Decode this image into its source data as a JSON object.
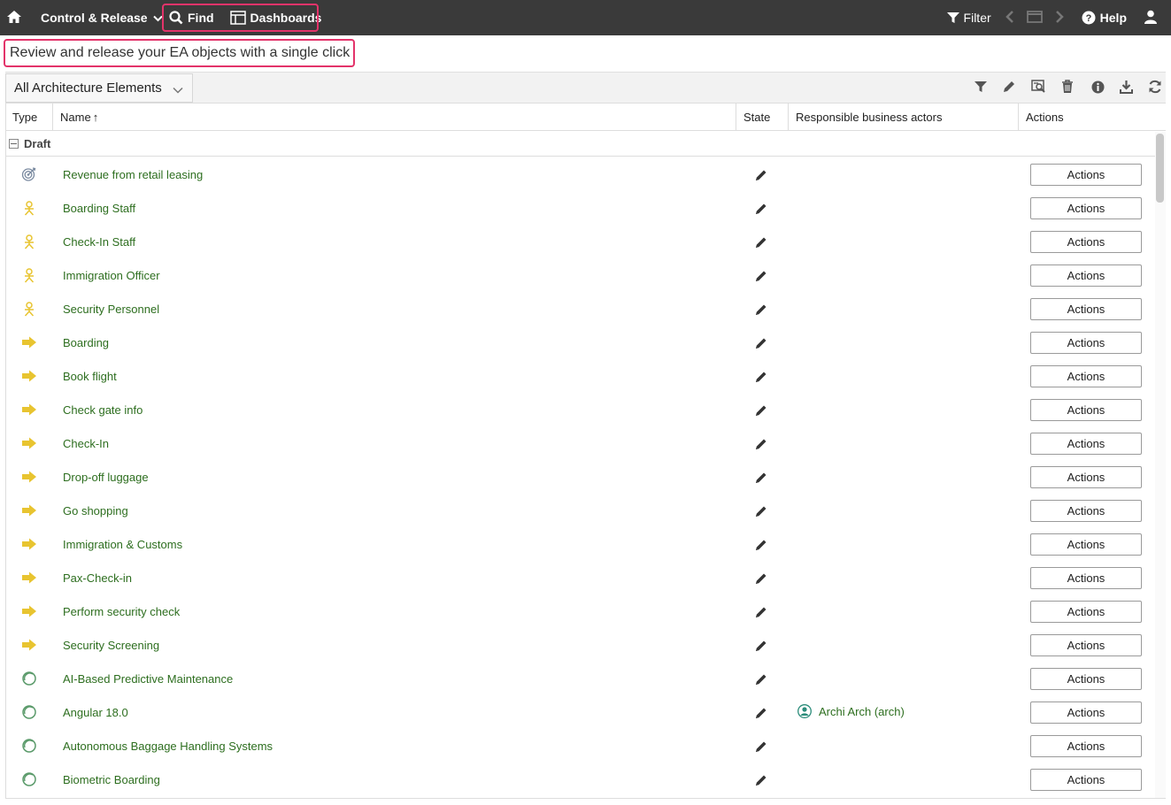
{
  "topbar": {
    "menu_label": "Control & Release",
    "find_label": "Find",
    "dashboards_label": "Dashboards",
    "filter_label": "Filter",
    "help_label": "Help"
  },
  "subtitle": "Review and release your EA objects with a single click",
  "toolbar": {
    "select_value": "All Architecture Elements"
  },
  "table": {
    "columns": {
      "type": "Type",
      "name": "Name",
      "name_sort": "↑",
      "state": "State",
      "responsible": "Responsible business actors",
      "actions": "Actions"
    },
    "group_label": "Draft",
    "rows": [
      {
        "type": "goal",
        "name": "Revenue from retail leasing",
        "responsible": "",
        "action": "Actions"
      },
      {
        "type": "actor",
        "name": "Boarding Staff",
        "responsible": "",
        "action": "Actions"
      },
      {
        "type": "actor",
        "name": "Check-In Staff",
        "responsible": "",
        "action": "Actions"
      },
      {
        "type": "actor",
        "name": "Immigration Officer",
        "responsible": "",
        "action": "Actions"
      },
      {
        "type": "actor",
        "name": "Security Personnel",
        "responsible": "",
        "action": "Actions"
      },
      {
        "type": "process",
        "name": "Boarding",
        "responsible": "",
        "action": "Actions"
      },
      {
        "type": "process",
        "name": "Book flight",
        "responsible": "",
        "action": "Actions"
      },
      {
        "type": "process",
        "name": "Check gate info",
        "responsible": "",
        "action": "Actions"
      },
      {
        "type": "process",
        "name": "Check-In",
        "responsible": "",
        "action": "Actions"
      },
      {
        "type": "process",
        "name": "Drop-off luggage",
        "responsible": "",
        "action": "Actions"
      },
      {
        "type": "process",
        "name": "Go shopping",
        "responsible": "",
        "action": "Actions"
      },
      {
        "type": "process",
        "name": "Immigration & Customs",
        "responsible": "",
        "action": "Actions"
      },
      {
        "type": "process",
        "name": "Pax-Check-in",
        "responsible": "",
        "action": "Actions"
      },
      {
        "type": "process",
        "name": "Perform security check",
        "responsible": "",
        "action": "Actions"
      },
      {
        "type": "process",
        "name": "Security Screening",
        "responsible": "",
        "action": "Actions"
      },
      {
        "type": "technology",
        "name": "AI-Based Predictive Maintenance",
        "responsible": "",
        "action": "Actions"
      },
      {
        "type": "technology",
        "name": "Angular 18.0",
        "responsible": "Archi Arch (arch)",
        "action": "Actions"
      },
      {
        "type": "technology",
        "name": "Autonomous Baggage Handling Systems",
        "responsible": "",
        "action": "Actions"
      },
      {
        "type": "technology",
        "name": "Biometric Boarding",
        "responsible": "",
        "action": "Actions"
      }
    ]
  },
  "colors": {
    "topbar_bg": "#3a3a3a",
    "highlight": "#e3336a",
    "link_green": "#2d6e1f",
    "actor_yellow": "#e8c430",
    "technology_green": "#5a9a6a",
    "goal_gray": "#7a8aa0"
  }
}
